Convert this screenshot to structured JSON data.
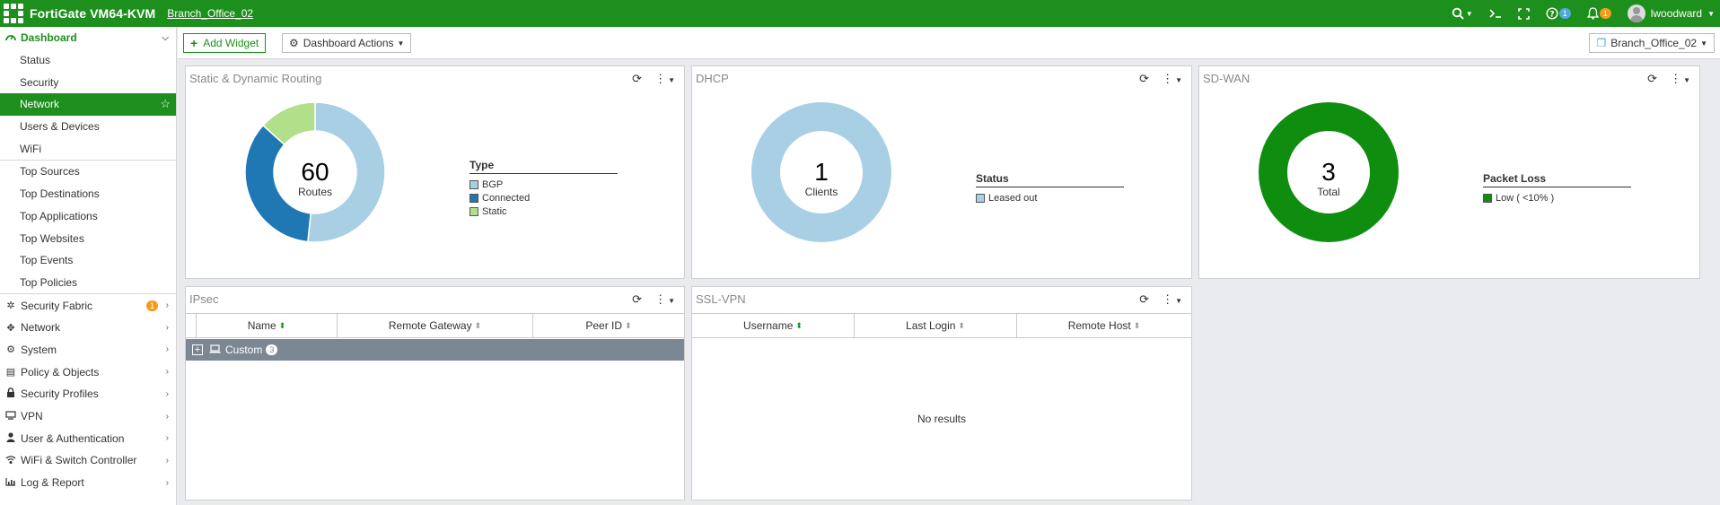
{
  "topbar": {
    "product": "FortiGate VM64-KVM",
    "hostname": "Branch_Office_02",
    "help_badge": "1",
    "alert_badge": "1",
    "username": "lwoodward"
  },
  "sidebar": {
    "dashboard_label": "Dashboard",
    "dashboard_items": [
      "Status",
      "Security",
      "Network",
      "Users & Devices",
      "WiFi"
    ],
    "active_item": "Network",
    "monitor_items": [
      "Top Sources",
      "Top Destinations",
      "Top Applications",
      "Top Websites",
      "Top Events",
      "Top Policies"
    ],
    "sections": [
      {
        "label": "Security Fabric",
        "icon": "fabric-icon",
        "badge": "1"
      },
      {
        "label": "Network",
        "icon": "network-icon"
      },
      {
        "label": "System",
        "icon": "gear-icon"
      },
      {
        "label": "Policy & Objects",
        "icon": "policy-icon"
      },
      {
        "label": "Security Profiles",
        "icon": "lock-icon"
      },
      {
        "label": "VPN",
        "icon": "monitor-icon"
      },
      {
        "label": "User & Authentication",
        "icon": "user-icon"
      },
      {
        "label": "WiFi & Switch Controller",
        "icon": "wifi-icon"
      },
      {
        "label": "Log & Report",
        "icon": "chart-icon"
      }
    ]
  },
  "toolbar": {
    "add_widget": "Add Widget",
    "dashboard_actions": "Dashboard Actions",
    "vdom": "Branch_Office_02"
  },
  "widgets": {
    "routing": {
      "title": "Static & Dynamic Routing",
      "total": "60",
      "total_label": "Routes",
      "legend_title": "Type",
      "legend": [
        {
          "label": "BGP",
          "color": "#a8cfe3"
        },
        {
          "label": "Connected",
          "color": "#1f78b4"
        },
        {
          "label": "Static",
          "color": "#b2df8a"
        }
      ]
    },
    "dhcp": {
      "title": "DHCP",
      "total": "1",
      "total_label": "Clients",
      "legend_title": "Status",
      "legend": [
        {
          "label": "Leased out",
          "color": "#a8cfe3"
        }
      ]
    },
    "sdwan": {
      "title": "SD-WAN",
      "total": "3",
      "total_label": "Total",
      "legend_title": "Packet Loss",
      "legend": [
        {
          "label": "Low ( <10% )",
          "color": "#0f8d0f"
        }
      ]
    },
    "ipsec": {
      "title": "IPsec",
      "columns": [
        "Name",
        "Remote Gateway",
        "Peer ID"
      ],
      "group_label": "Custom",
      "group_count": "3"
    },
    "sslvpn": {
      "title": "SSL-VPN",
      "columns": [
        "Username",
        "Last Login",
        "Remote Host"
      ],
      "empty_text": "No results"
    }
  },
  "chart_data": [
    {
      "type": "pie",
      "title": "Static & Dynamic Routing",
      "categories": [
        "BGP",
        "Connected",
        "Static"
      ],
      "values": [
        31,
        21,
        8
      ],
      "total": 60
    },
    {
      "type": "pie",
      "title": "DHCP",
      "categories": [
        "Leased out"
      ],
      "values": [
        1
      ],
      "total": 1
    },
    {
      "type": "pie",
      "title": "SD-WAN",
      "categories": [
        "Low ( <10% )"
      ],
      "values": [
        3
      ],
      "total": 3
    }
  ]
}
